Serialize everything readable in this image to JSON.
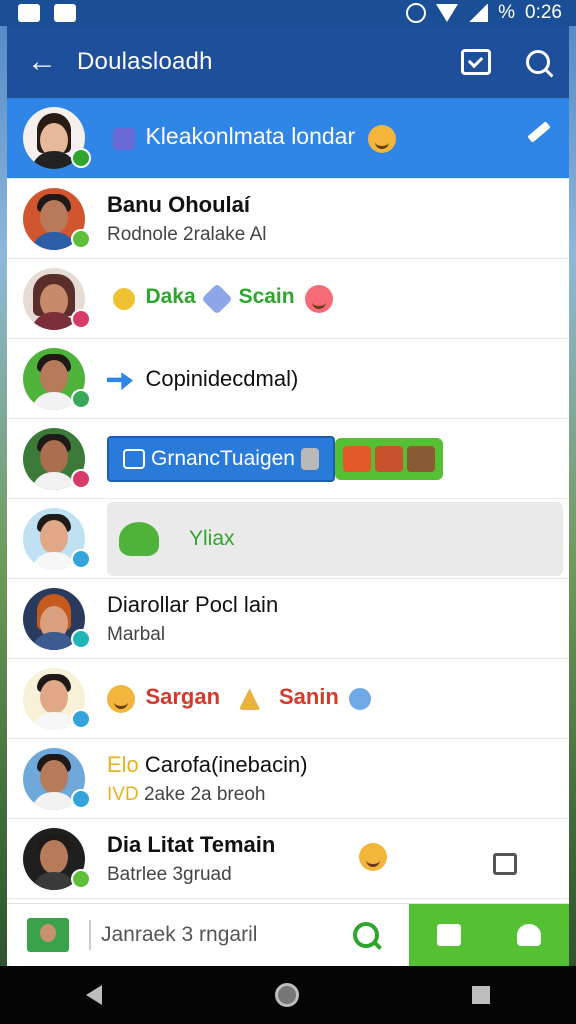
{
  "status_bar": {
    "time": "0:26",
    "battery": "%"
  },
  "header": {
    "title": "Doulasloadh",
    "back_icon": "back-arrow-icon",
    "actions": [
      "chat-box-icon",
      "search-icon"
    ]
  },
  "highlighted": {
    "text": "Kleakonlmata londar"
  },
  "rows": [
    {
      "name": "Banu Ohoulaí",
      "sub": "Rodnole 2ralake Al",
      "badge_color": "#5fbf3a"
    },
    {
      "text1": "Daka",
      "text2": "Scain",
      "badge_color": "#d83a6a"
    },
    {
      "text": "Copinidecdmal)",
      "badge_color": "#3aa85b"
    },
    {
      "pill": "GrnancTuaigen",
      "badge_color": "#d83a6a"
    },
    {
      "text": "Yliax",
      "badge_color": "#36a4dc"
    },
    {
      "name": "Diarollar Pocl lain",
      "sub": "Marbal",
      "badge_color": "#20b6b8"
    },
    {
      "text1": "Sargan",
      "text2": "Sanin",
      "badge_color": "#36a4dc"
    },
    {
      "prefix1": "Elo",
      "name": "Carofa(inebacin)",
      "prefix2": "IVD",
      "sub": "2ake 2a breoh",
      "badge_color": "#36a4dc"
    },
    {
      "name": "Dia Litat Temain",
      "sub": "Batrlee 3gruad",
      "badge_color": "#5fbf3a"
    }
  ],
  "composer": {
    "placeholder": "Janraek 3 rngaril"
  },
  "colors": {
    "header": "#1e4f9a",
    "highlight": "#2f86e6",
    "green": "#56c033"
  }
}
